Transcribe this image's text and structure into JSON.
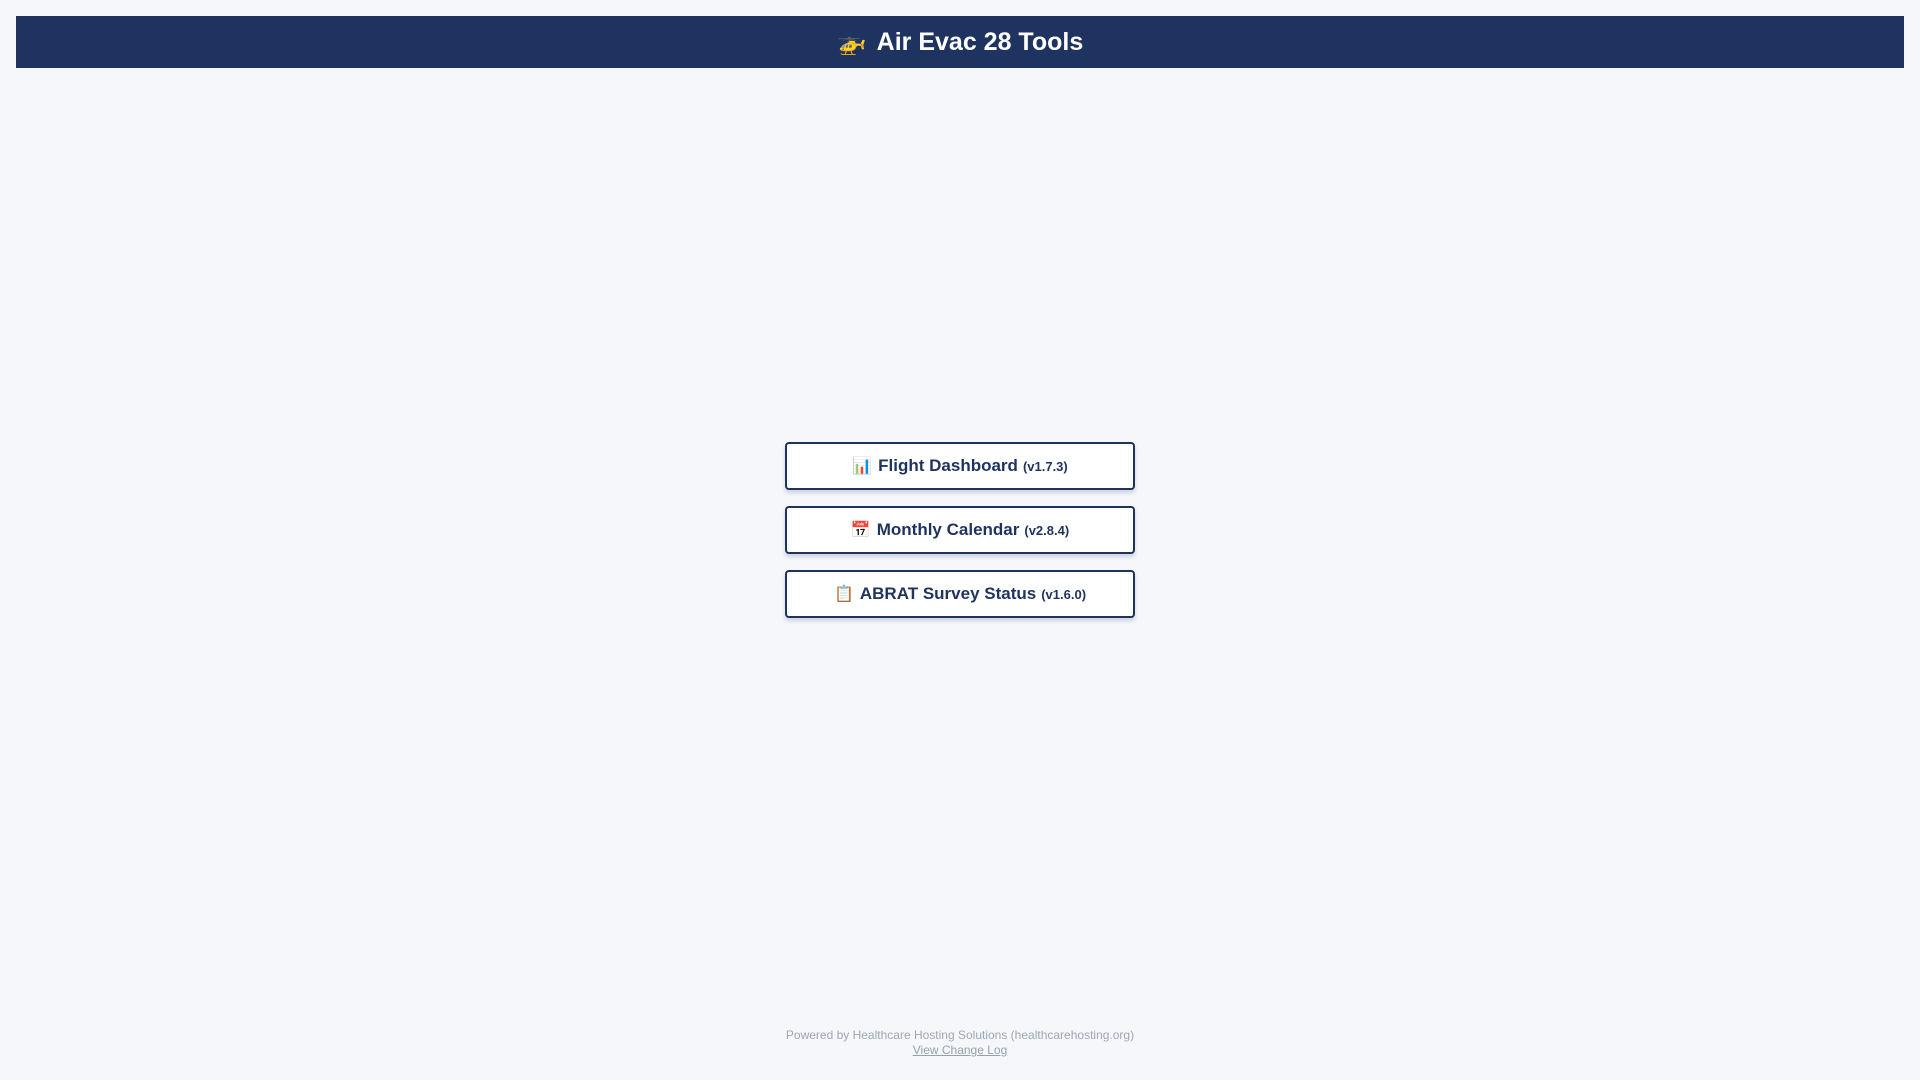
{
  "header": {
    "icon": "helicopter-icon",
    "icon_glyph": "🚁",
    "title": "Air Evac 28 Tools"
  },
  "menu": {
    "items": [
      {
        "icon": "bar-chart-icon",
        "icon_glyph": "📊",
        "label": "Flight Dashboard",
        "version": "(v1.7.3)"
      },
      {
        "icon": "calendar-icon",
        "icon_glyph": "📅",
        "label": "Monthly Calendar",
        "version": "(v2.8.4)"
      },
      {
        "icon": "clipboard-icon",
        "icon_glyph": "📋",
        "label": "ABRAT Survey Status",
        "version": "(v1.6.0)"
      }
    ]
  },
  "footer": {
    "powered_by": "Powered by Healthcare Hosting Solutions (healthcarehosting.org)",
    "changelog_link": "View Change Log"
  },
  "colors": {
    "header_bg": "#1e335f",
    "page_bg": "#f5f7fb",
    "button_border": "#1e335f",
    "footer_text": "#a0a6b0"
  }
}
